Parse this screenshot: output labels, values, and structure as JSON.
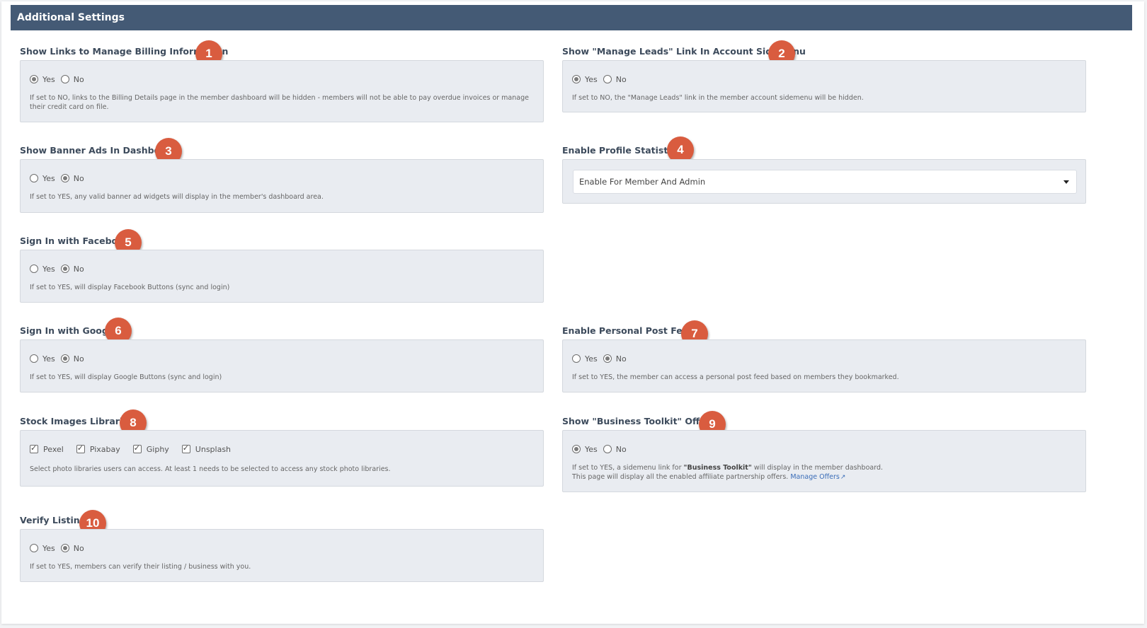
{
  "header": {
    "title": "Additional Settings"
  },
  "fields": {
    "billing": {
      "label": "Show Links to Manage Billing Information",
      "badge": "1",
      "options": [
        "Yes",
        "No"
      ],
      "selected": "Yes",
      "help": "If set to NO, links to the Billing Details page in the member dashboard will be hidden - members will not be able to pay overdue invoices or manage their credit card on file."
    },
    "leads": {
      "label": "Show \"Manage Leads\" Link In Account Sidemenu",
      "badge": "2",
      "options": [
        "Yes",
        "No"
      ],
      "selected": "Yes",
      "help": "If set to NO, the \"Manage Leads\" link in the member account sidemenu will be hidden."
    },
    "banner": {
      "label": "Show Banner Ads In Dashboard",
      "badge": "3",
      "options": [
        "Yes",
        "No"
      ],
      "selected": "No",
      "help": "If set to YES, any valid banner ad widgets will display in the member's dashboard area."
    },
    "stats": {
      "label": "Enable Profile Statistics",
      "badge": "4",
      "select_value": "Enable For Member And Admin"
    },
    "facebook": {
      "label": "Sign In with Facebook",
      "badge": "5",
      "options": [
        "Yes",
        "No"
      ],
      "selected": "No",
      "help": "If set to YES, will display Facebook Buttons (sync and login)"
    },
    "google": {
      "label": "Sign In with Google",
      "badge": "6",
      "options": [
        "Yes",
        "No"
      ],
      "selected": "No",
      "help": "If set to YES, will display Google Buttons (sync and login)"
    },
    "feed": {
      "label": "Enable Personal Post Feed",
      "badge": "7",
      "options": [
        "Yes",
        "No"
      ],
      "selected": "No",
      "help": "If set to YES, the member can access a personal post feed based on members they bookmarked."
    },
    "stock": {
      "label": "Stock Images Libraries",
      "badge": "8",
      "checkboxes": [
        {
          "label": "Pexel",
          "checked": true
        },
        {
          "label": "Pixabay",
          "checked": true
        },
        {
          "label": "Giphy",
          "checked": true
        },
        {
          "label": "Unsplash",
          "checked": true
        }
      ],
      "help": "Select photo libraries users can access. At least 1 needs to be selected to access any stock photo libraries."
    },
    "toolkit": {
      "label": "Show \"Business Toolkit\" Offers",
      "badge": "9",
      "options": [
        "Yes",
        "No"
      ],
      "selected": "Yes",
      "help_prefix": "If set to YES, a sidemenu link for ",
      "help_bold": "\"Business Toolkit\"",
      "help_suffix": " will display in the member dashboard.",
      "help_line2": "This page will display all the enabled affiliate partnership offers.",
      "link": "Manage Offers",
      "link_icon": "external-link-icon"
    },
    "verify": {
      "label": "Verify Listing",
      "badge": "10",
      "options": [
        "Yes",
        "No"
      ],
      "selected": "No",
      "help": "If set to YES, members can verify their listing / business with you."
    }
  },
  "colors": {
    "header_bg": "#445a75",
    "badge_bg": "#d95c3f",
    "box_bg": "#e9ecf1",
    "link": "#3a6db8"
  }
}
